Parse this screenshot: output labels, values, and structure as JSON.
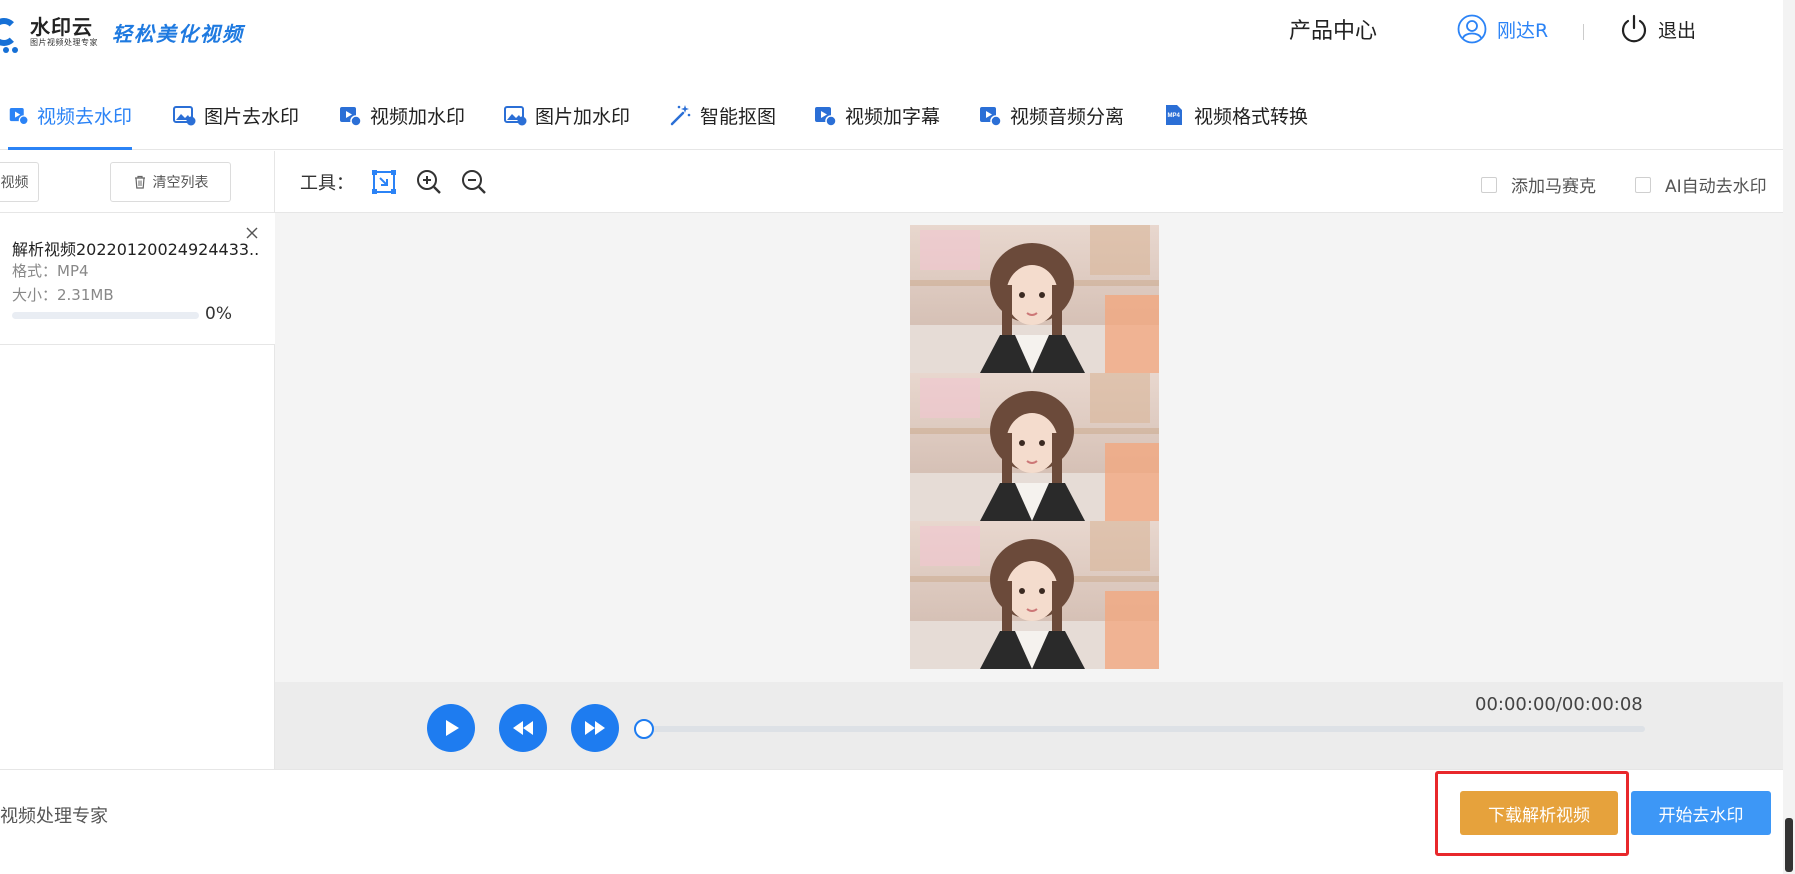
{
  "header": {
    "logo_name": "水印云",
    "logo_sub": "图片视频处理专家",
    "slogan": "轻松美化视频",
    "product_center": "产品中心",
    "user_name": "刚达R",
    "logout": "退出"
  },
  "tabs": [
    {
      "label": "视频去水印",
      "icon": "video-icon",
      "active": true
    },
    {
      "label": "图片去水印",
      "icon": "image-icon",
      "active": false
    },
    {
      "label": "视频加水印",
      "icon": "video-add-icon",
      "active": false
    },
    {
      "label": "图片加水印",
      "icon": "image-add-icon",
      "active": false
    },
    {
      "label": "智能抠图",
      "icon": "magic-wand-icon",
      "active": false
    },
    {
      "label": "视频加字幕",
      "icon": "video-subtitle-icon",
      "active": false
    },
    {
      "label": "视频音频分离",
      "icon": "video-audio-icon",
      "active": false
    },
    {
      "label": "视频格式转换",
      "icon": "mp4-icon",
      "active": false
    }
  ],
  "left_panel": {
    "add_button": "视频",
    "clear_button": "清空列表",
    "file": {
      "name": "解析视频20220120024924433...",
      "format": "格式：MP4",
      "size": "大小：2.31MB",
      "progress": 0,
      "progress_label": "0%"
    }
  },
  "workspace": {
    "tools_label": "工具：",
    "options": [
      {
        "label": "添加马赛克",
        "checked": false
      },
      {
        "label": "AI自动去水印",
        "checked": false
      }
    ]
  },
  "player": {
    "time": "00:00:00/00:00:08",
    "position": 0
  },
  "footer": {
    "text": "视频处理专家",
    "download_button": "下载解析视频",
    "start_button": "开始去水印"
  },
  "colors": {
    "accent": "#2b83f6",
    "download": "#e6a23c",
    "start": "#3d97f6",
    "highlight": "#e8282b"
  }
}
